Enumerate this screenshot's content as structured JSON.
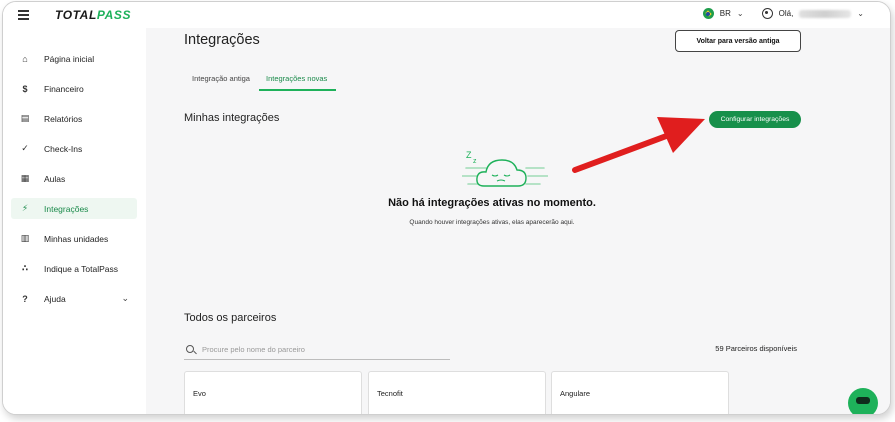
{
  "topbar": {
    "logo_total": "TOTAL",
    "logo_pass": "PASS",
    "country": "BR",
    "greeting": "Olá,"
  },
  "sidebar": {
    "items": [
      {
        "label": "Página inicial",
        "icon": "home-icon"
      },
      {
        "label": "Financeiro",
        "icon": "dollar-icon"
      },
      {
        "label": "Relatórios",
        "icon": "report-icon"
      },
      {
        "label": "Check-Ins",
        "icon": "checklist-icon"
      },
      {
        "label": "Aulas",
        "icon": "calendar-icon"
      },
      {
        "label": "Integrações",
        "icon": "plug-icon",
        "active": true
      },
      {
        "label": "Minhas unidades",
        "icon": "store-icon"
      },
      {
        "label": "Indique a TotalPass",
        "icon": "share-icon"
      },
      {
        "label": "Ajuda",
        "icon": "help-icon"
      }
    ]
  },
  "main": {
    "title": "Integrações",
    "back_button": "Voltar para versão antiga",
    "tabs": [
      {
        "label": "Integração antiga"
      },
      {
        "label": "Integrações novas",
        "active": true
      }
    ],
    "my_integrations_title": "Minhas integrações",
    "configure_button": "Configurar integrações",
    "empty_title": "Não há integrações ativas no momento.",
    "empty_subtitle": "Quando houver integrações ativas, elas aparecerão aqui.",
    "empty_icon": "sleeping-cloud-icon",
    "partners_title": "Todos os parceiros",
    "search_placeholder": "Procure pelo nome do parceiro",
    "partners_count": "59 Parceiros disponíveis",
    "partners": [
      "Evo",
      "Tecnofit",
      "Angulare"
    ]
  },
  "colors": {
    "brand_green": "#1eb15a",
    "button_green": "#17904b",
    "annotation_arrow": "#e01e1e"
  }
}
